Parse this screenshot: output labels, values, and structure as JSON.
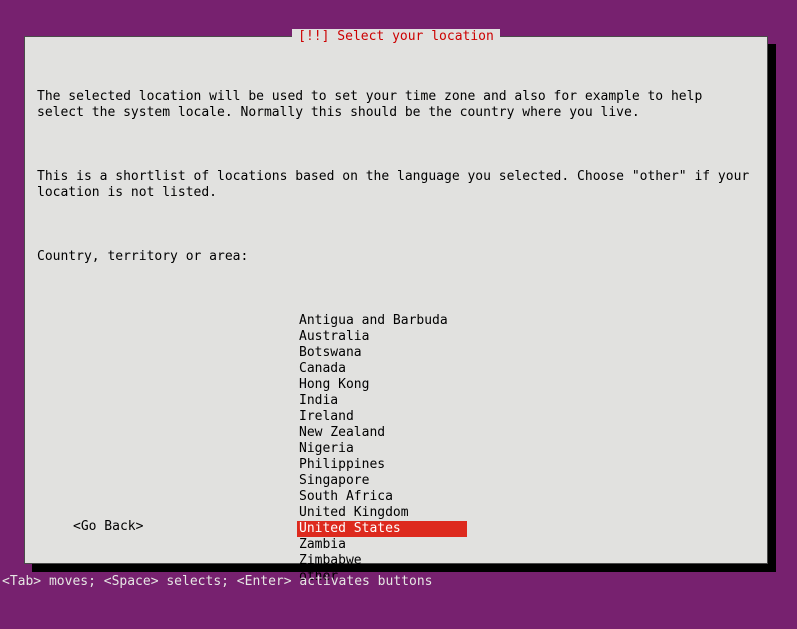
{
  "dialog": {
    "title": "[!!] Select your location",
    "paragraph1": "The selected location will be used to set your time zone and also for example to help select the system locale. Normally this should be the country where you live.",
    "paragraph2": "This is a shortlist of locations based on the language you selected. Choose \"other\" if your location is not listed.",
    "prompt": "Country, territory or area:",
    "items": [
      "Antigua and Barbuda",
      "Australia",
      "Botswana",
      "Canada",
      "Hong Kong",
      "India",
      "Ireland",
      "New Zealand",
      "Nigeria",
      "Philippines",
      "Singapore",
      "South Africa",
      "United Kingdom",
      "United States",
      "Zambia",
      "Zimbabwe",
      "other"
    ],
    "selected_index": 13,
    "go_back": "<Go Back>"
  },
  "footer": {
    "hint": "<Tab> moves; <Space> selects; <Enter> activates buttons"
  },
  "colors": {
    "background": "#77216f",
    "panel": "#e1e1df",
    "title": "#cc0000",
    "highlight": "#dd2a1e"
  }
}
